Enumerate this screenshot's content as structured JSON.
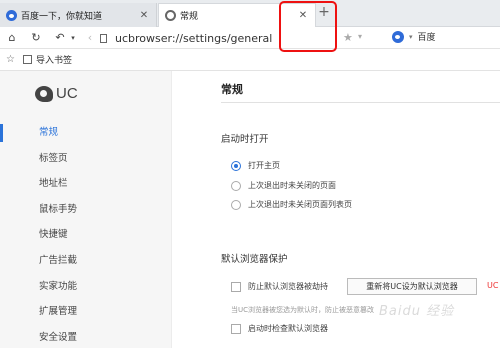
{
  "tabs": [
    {
      "label": "百度一下，你就知道",
      "icon": "baidu-paw-icon",
      "active": false
    },
    {
      "label": "常规",
      "icon": "gear-icon",
      "active": true
    }
  ],
  "toolbar": {
    "url": "ucbrowser://settings/general",
    "search_engine": "百度"
  },
  "bookmarks": {
    "import_label": "导入书签"
  },
  "sidebar": {
    "logo_text": "UC",
    "items": [
      {
        "label": "常规",
        "active": true
      },
      {
        "label": "标签页"
      },
      {
        "label": "地址栏"
      },
      {
        "label": "鼠标手势"
      },
      {
        "label": "快捷键"
      },
      {
        "label": "广告拦截"
      },
      {
        "label": "实家功能"
      },
      {
        "label": "扩展管理"
      },
      {
        "label": "安全设置"
      }
    ]
  },
  "main": {
    "title": "常规",
    "startup": {
      "heading": "启动时打开",
      "options": [
        {
          "label": "打开主页",
          "checked": true
        },
        {
          "label": "上次退出时未关闭的页面",
          "checked": false
        },
        {
          "label": "上次退出时未关闭页面列表页",
          "checked": false
        }
      ]
    },
    "default_browser": {
      "heading": "默认浏览器保护",
      "hijack_option": "防止默认浏览器被劫持",
      "set_default_button": "重新将UC设为默认浏览器",
      "status": "UC",
      "hint": "当UC浏览器被您选为默认时，防止被恶意篡改",
      "check_on_start": "启动时检查默认浏览器"
    }
  },
  "watermark": "Baidu 经验",
  "colors": {
    "accent": "#2b73d9",
    "highlight": "#e11111"
  }
}
